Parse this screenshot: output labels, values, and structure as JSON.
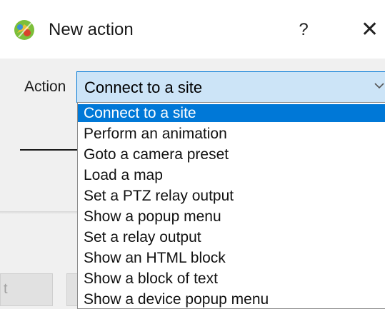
{
  "window": {
    "title": "New action",
    "help_label": "?",
    "close_label": "✕"
  },
  "form": {
    "action_label": "Action",
    "action_value": "Connect to a site"
  },
  "dropdown": {
    "items": [
      "Connect to a site",
      "Perform an animation",
      "Goto a camera preset",
      "Load a map",
      "Set a PTZ relay output",
      "Show a popup menu",
      "Set a relay output",
      "Show an HTML block",
      "Show a block of text",
      "Show a device popup menu"
    ],
    "selected": "Connect to a site"
  },
  "footer": {
    "left_button_label": "t"
  },
  "colors": {
    "selection": "#0078d7",
    "combo_fill": "#cce4f7"
  },
  "icons": {
    "app": "paintbrush-palette-icon",
    "chevron": "chevron-down-icon"
  }
}
